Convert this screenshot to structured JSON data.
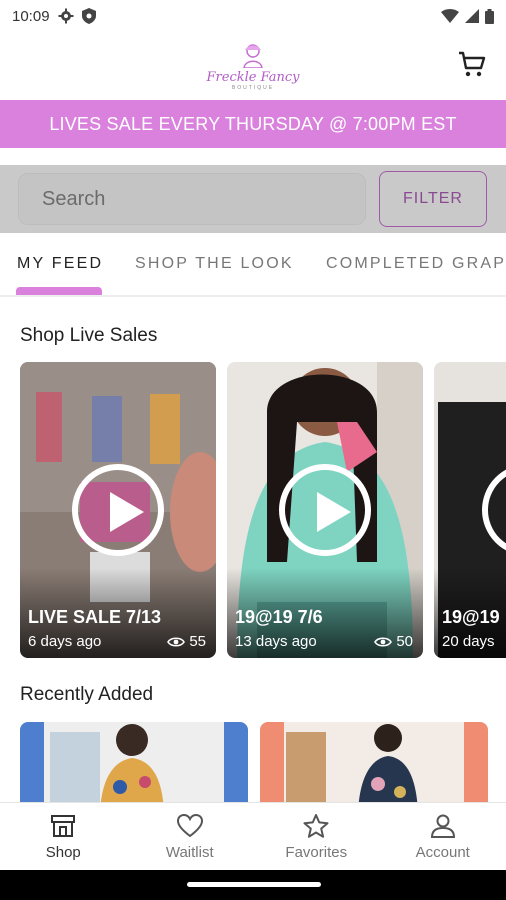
{
  "status": {
    "time": "10:09",
    "icons": [
      "gear-icon",
      "shield-icon",
      "wifi-icon",
      "signal-icon",
      "battery-icon"
    ]
  },
  "header": {
    "logo_text": "Freckle Fancy",
    "logo_subtext": "BOUTIQUE",
    "cart_icon": "cart-icon"
  },
  "banner": {
    "text": "LIVES SALE EVERY THURSDAY @ 7:00PM EST",
    "color": "#d981dd"
  },
  "search": {
    "placeholder": "Search",
    "filter_label": "FILTER"
  },
  "tabs": [
    "MY FEED",
    "SHOP THE LOOK",
    "COMPLETED GRAP"
  ],
  "live_section": {
    "title": "Shop Live Sales",
    "cards": [
      {
        "title": "LIVE SALE 7/13",
        "age": "6 days ago",
        "views": "55"
      },
      {
        "title": "19@19 7/6",
        "age": "13 days ago",
        "views": "50"
      },
      {
        "title": "19@19",
        "age": "20 days"
      }
    ]
  },
  "recent_section": {
    "title": "Recently Added"
  },
  "bottom_nav": [
    {
      "label": "Shop",
      "icon": "store-icon"
    },
    {
      "label": "Waitlist",
      "icon": "heart-icon"
    },
    {
      "label": "Favorites",
      "icon": "star-icon"
    },
    {
      "label": "Account",
      "icon": "person-icon"
    }
  ]
}
